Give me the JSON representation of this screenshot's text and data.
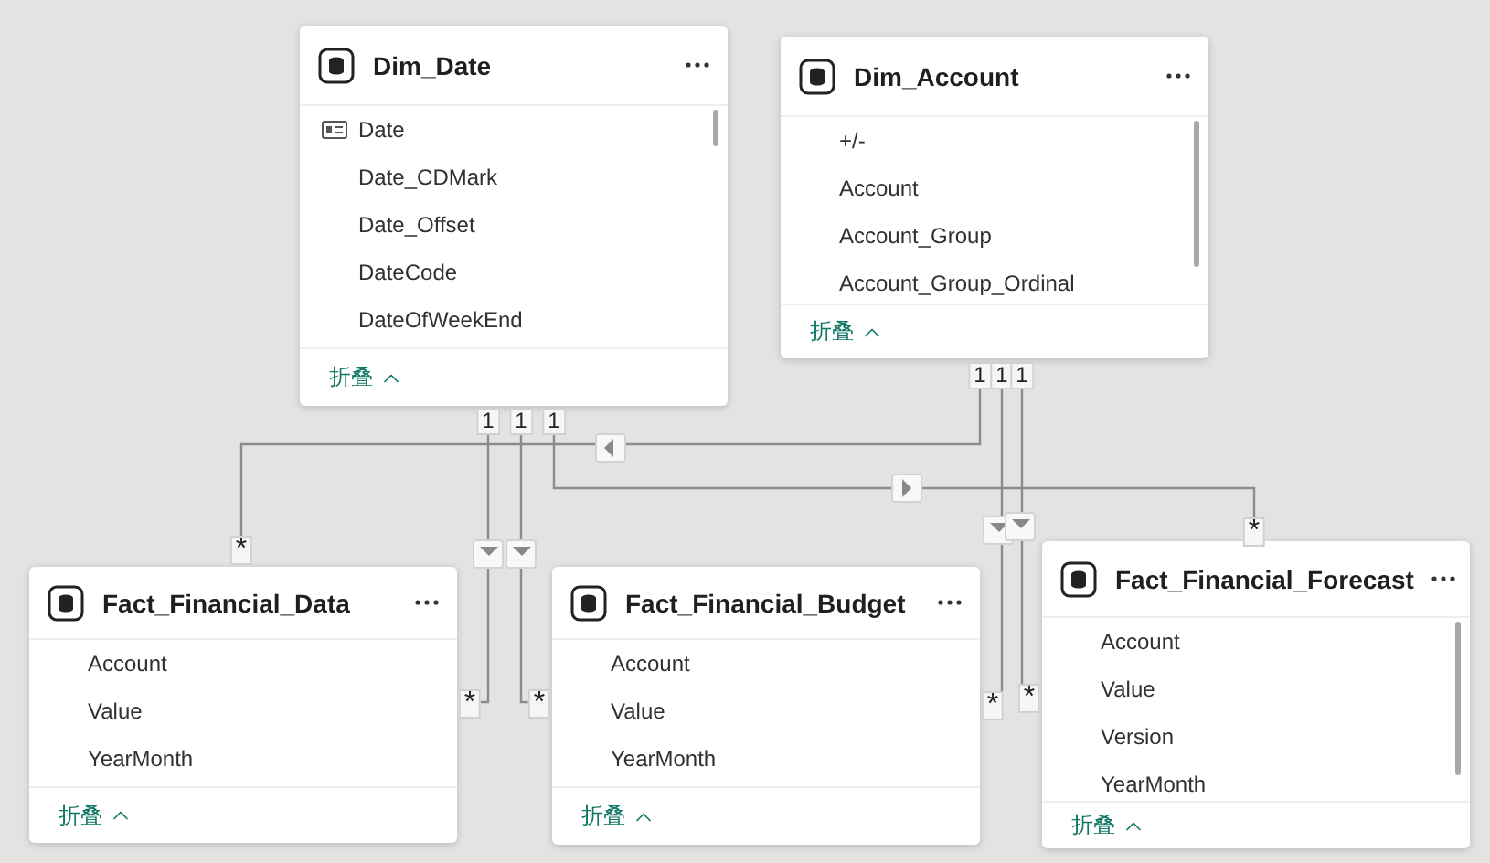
{
  "tables": [
    {
      "name": "Dim_Date",
      "fields": [
        {
          "label": "Date",
          "kind": "key"
        },
        {
          "label": "Date_CDMark",
          "kind": "column"
        },
        {
          "label": "Date_Offset",
          "kind": "column"
        },
        {
          "label": "DateCode",
          "kind": "column"
        },
        {
          "label": "DateOfWeekEnd",
          "kind": "column"
        }
      ],
      "collapse": "折叠"
    },
    {
      "name": "Dim_Account",
      "fields": [
        {
          "label": "+/-",
          "kind": "column"
        },
        {
          "label": "Account",
          "kind": "column"
        },
        {
          "label": "Account_Group",
          "kind": "column"
        },
        {
          "label": "Account_Group_Ordinal",
          "kind": "column"
        }
      ],
      "collapse": "折叠"
    },
    {
      "name": "Fact_Financial_Data",
      "fields": [
        {
          "label": "Account",
          "kind": "column"
        },
        {
          "label": "Value",
          "kind": "column"
        },
        {
          "label": "YearMonth",
          "kind": "column"
        }
      ],
      "collapse": "折叠"
    },
    {
      "name": "Fact_Financial_Budget",
      "fields": [
        {
          "label": "Account",
          "kind": "column"
        },
        {
          "label": "Value",
          "kind": "column"
        },
        {
          "label": "YearMonth",
          "kind": "column"
        }
      ],
      "collapse": "折叠"
    },
    {
      "name": "Fact_Financial_Forecast",
      "fields": [
        {
          "label": "Account",
          "kind": "column"
        },
        {
          "label": "Value",
          "kind": "column"
        },
        {
          "label": "Version",
          "kind": "column"
        },
        {
          "label": "YearMonth",
          "kind": "column"
        }
      ],
      "collapse": "折叠"
    }
  ],
  "relationships": [
    {
      "one": "1",
      "many": "*"
    },
    {
      "one": "1",
      "many": "*"
    },
    {
      "one": "1",
      "many": "*"
    },
    {
      "one": "1",
      "many": "*"
    },
    {
      "one": "1",
      "many": "*"
    },
    {
      "one": "1",
      "many": "*"
    }
  ]
}
